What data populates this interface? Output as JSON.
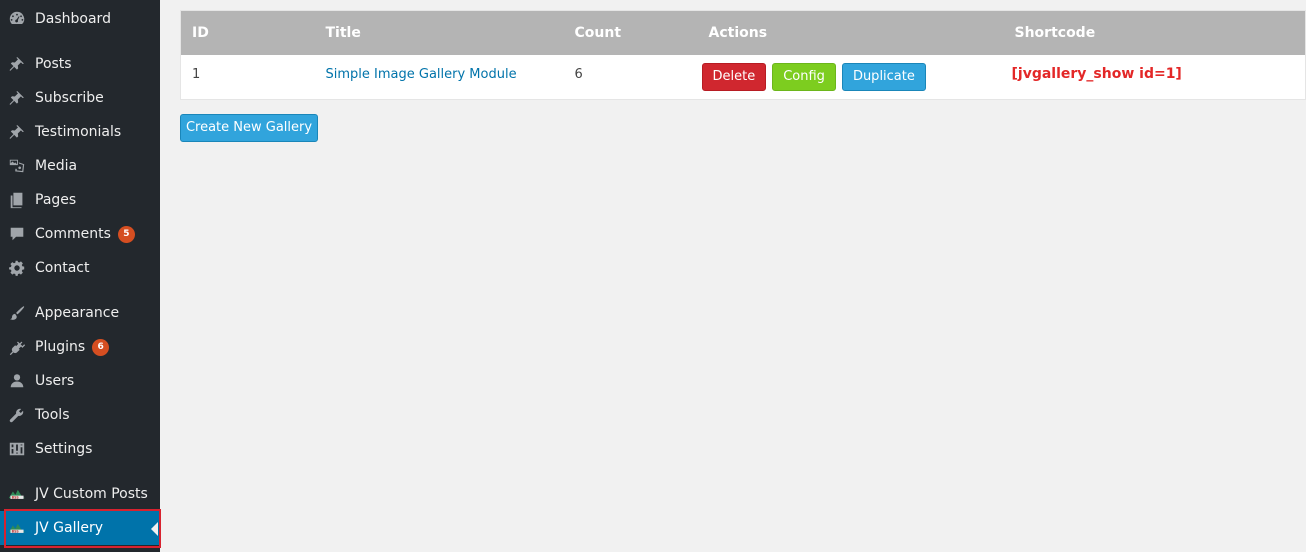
{
  "sidebar": {
    "items": [
      {
        "label": "Dashboard",
        "icon": "dashboard-icon"
      },
      {
        "label": "Posts",
        "icon": "pin-icon"
      },
      {
        "label": "Subscribe",
        "icon": "pin-icon"
      },
      {
        "label": "Testimonials",
        "icon": "pin-icon"
      },
      {
        "label": "Media",
        "icon": "media-icon"
      },
      {
        "label": "Pages",
        "icon": "pages-icon"
      },
      {
        "label": "Comments",
        "icon": "comment-icon",
        "badge": "5"
      },
      {
        "label": "Contact",
        "icon": "gear-icon"
      },
      {
        "label": "Appearance",
        "icon": "brush-icon"
      },
      {
        "label": "Plugins",
        "icon": "plug-icon",
        "badge": "6"
      },
      {
        "label": "Users",
        "icon": "user-icon"
      },
      {
        "label": "Tools",
        "icon": "wrench-icon"
      },
      {
        "label": "Settings",
        "icon": "settings-icon"
      },
      {
        "label": "JV Custom Posts",
        "icon": "bss-logo-icon"
      },
      {
        "label": "JV Gallery",
        "icon": "bss-logo-icon",
        "current": true
      }
    ]
  },
  "table": {
    "headers": [
      "ID",
      "Title",
      "Count",
      "Actions",
      "Shortcode"
    ],
    "rows": [
      {
        "id": "1",
        "title": "Simple Image Gallery Module",
        "count": "6",
        "actions": {
          "delete": "Delete",
          "config": "Config",
          "duplicate": "Duplicate"
        },
        "shortcode": "[jvgallery_show id=1]"
      }
    ]
  },
  "create_button": "Create New Gallery",
  "colors": {
    "sidebar_bg": "#23282d",
    "current_bg": "#0073aa",
    "header_bg": "#b4b4b4",
    "delete": "#d0272f",
    "config": "#7dcd1f",
    "duplicate": "#31a4dc",
    "shortcode": "#e32727",
    "badge": "#d54e21"
  }
}
